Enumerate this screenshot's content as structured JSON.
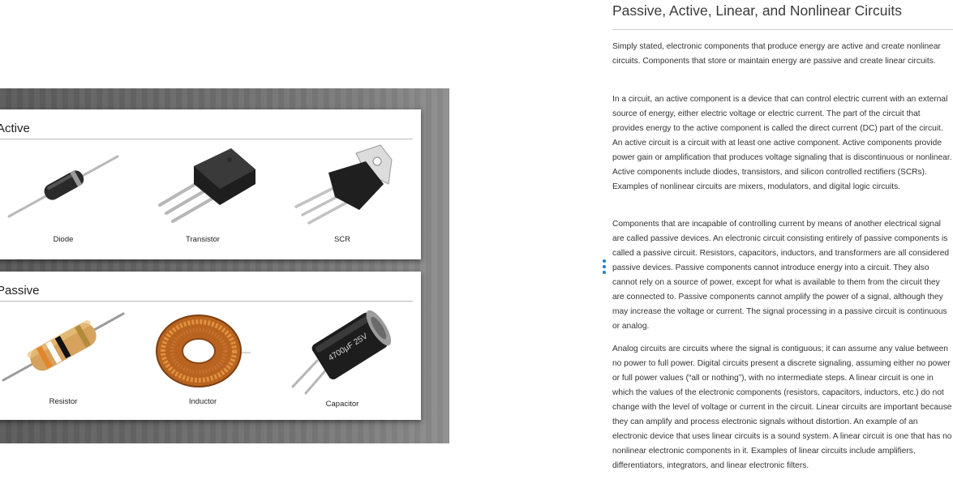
{
  "figure": {
    "groups": [
      {
        "title": "Active",
        "items": [
          {
            "label": "Diode",
            "icon": "diode-icon"
          },
          {
            "label": "Transistor",
            "icon": "transistor-icon"
          },
          {
            "label": "SCR",
            "icon": "scr-icon"
          }
        ]
      },
      {
        "title": "Passive",
        "items": [
          {
            "label": "Resistor",
            "icon": "resistor-icon"
          },
          {
            "label": "Inductor",
            "icon": "inductor-icon"
          },
          {
            "label": "Capacitor",
            "icon": "capacitor-icon",
            "marking": "4700μF 25V"
          }
        ]
      }
    ]
  },
  "article": {
    "title": "Passive, Active, Linear, and Nonlinear Circuits",
    "paragraphs": [
      "Simply stated, electronic components that produce energy are active and create nonlinear circuits. Components that store or maintain energy are passive and create linear circuits.",
      "In a circuit, an active component is a device that can control electric current with an external source of energy, either electric voltage or electric current. The part of the circuit that provides energy to the active component is called the direct current (DC) part of the circuit. An active circuit is a circuit with at least one active component. Active components provide power gain or amplification that produces voltage signaling that is discontinuous or nonlinear. Active components include diodes, transistors, and silicon controlled rectifiers (SCRs). Examples of nonlinear circuits are mixers, modulators, and digital logic circuits.",
      "Components that are incapable of controlling current by means of another electrical signal are called passive devices. An electronic circuit consisting entirely of passive components is called a passive circuit. Resistors, capacitors, inductors, and transformers are all considered passive devices. Passive components cannot introduce energy into a circuit. They also cannot rely on a source of power, except for what is available to them from the circuit they are connected to. Passive components cannot amplify the power of a signal, although they may increase the voltage or current. The signal processing in a passive circuit is continuous or analog.",
      "Analog circuits are circuits where the signal is contiguous; it can assume any value between no power to full power. Digital circuits present a discrete signaling, assuming either no power or full power values (“all or nothing”), with no intermediate steps. A linear circuit is one in which the values of the electronic components (resistors, capacitors, inductors, etc.) do not change with the level of voltage or current in the circuit. Linear circuits are important because they can amplify and process electronic signals without distortion. An example of an electronic device that uses linear circuits is a sound system. A linear circuit is one that has no nonlinear electronic components in it. Examples of linear circuits include amplifiers, differentiators, integrators, and linear electronic filters."
    ]
  },
  "colors": {
    "heading": "#3a3a3a",
    "body_text": "#333333",
    "handle_accent": "#2b7fc9",
    "figure_background": "#6a6a6a"
  }
}
